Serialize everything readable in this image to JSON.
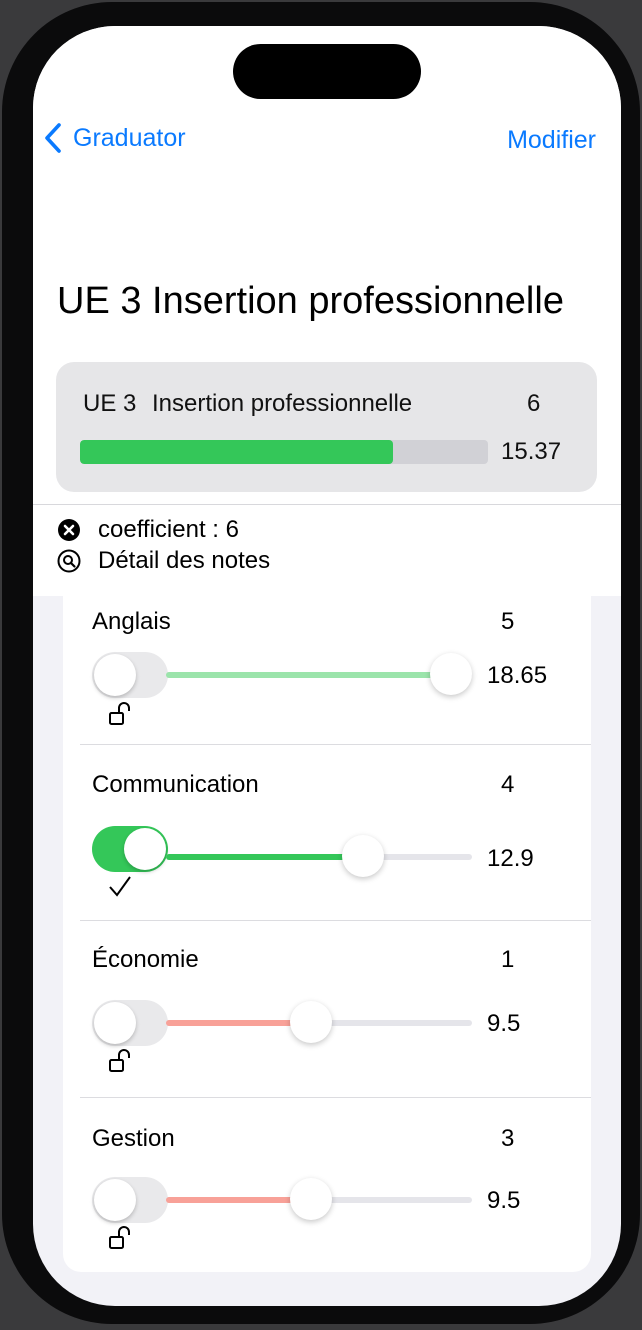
{
  "nav": {
    "back_label": "Graduator",
    "right_label": "Modifier"
  },
  "page_title": "UE 3 Insertion professionnelle",
  "ue_summary": {
    "code": "UE 3",
    "name": "Insertion professionnelle",
    "coefficient": "6",
    "average": "15.37",
    "progress": 0.768,
    "bar_color": "#34c759"
  },
  "info": {
    "coefficient_label": "coefficient : 6",
    "details_label": "Détail des notes",
    "coefficient_icon": "xmark-circle-fill-icon",
    "details_icon": "magnifyingglass-circle-icon"
  },
  "subjects": [
    {
      "name": "Anglais",
      "coefficient": "5",
      "value": "18.65",
      "fraction": 0.9325,
      "locked": false,
      "fill_color": "#9be4ab",
      "state_icon": "unlock-icon"
    },
    {
      "name": "Communication",
      "coefficient": "4",
      "value": "12.9",
      "fraction": 0.645,
      "locked": true,
      "fill_color": "#34c759",
      "state_icon": "checkmark-icon"
    },
    {
      "name": "Économie",
      "coefficient": "1",
      "value": "9.5",
      "fraction": 0.475,
      "locked": false,
      "fill_color": "#f8a198",
      "state_icon": "unlock-icon"
    },
    {
      "name": "Gestion",
      "coefficient": "3",
      "value": "9.5",
      "fraction": 0.475,
      "locked": false,
      "fill_color": "#f8a198",
      "state_icon": "unlock-icon"
    }
  ]
}
